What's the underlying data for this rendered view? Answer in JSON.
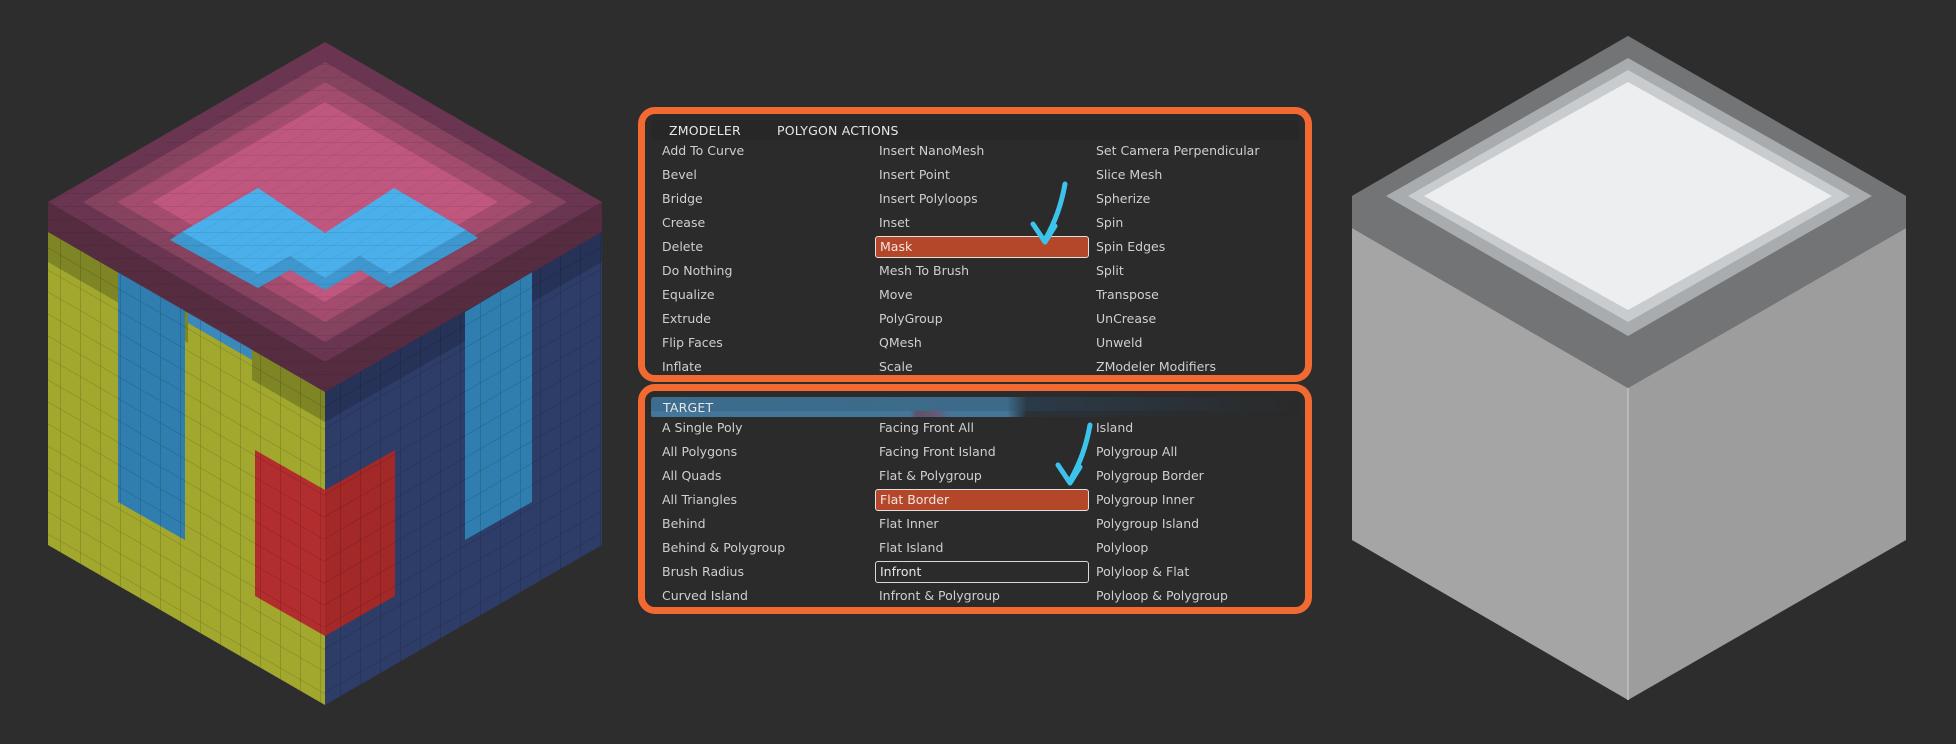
{
  "zmodeler_panel": {
    "tab_zmodeler": "ZMODELER",
    "tab_polygon_actions": "POLYGON ACTIONS",
    "col1": [
      "Add To Curve",
      "Bevel",
      "Bridge",
      "Crease",
      "Delete",
      "Do Nothing",
      "Equalize",
      "Extrude",
      "Flip Faces",
      "Inflate"
    ],
    "col2": [
      "Insert NanoMesh",
      "Insert Point",
      "Insert Polyloops",
      "Inset",
      "Mask",
      "Mesh To Brush",
      "Move",
      "PolyGroup",
      "QMesh",
      "Scale"
    ],
    "col3": [
      "Set Camera Perpendicular",
      "Slice Mesh",
      "Spherize",
      "Spin",
      "Spin Edges",
      "Split",
      "Transpose",
      "UnCrease",
      "Unweld",
      "ZModeler Modifiers"
    ],
    "selected": "Mask"
  },
  "target_panel": {
    "title": "TARGET",
    "col1": [
      "A Single Poly",
      "All Polygons",
      "All Quads",
      "All Triangles",
      "Behind",
      "Behind & Polygroup",
      "Brush Radius",
      "Curved Island"
    ],
    "col2": [
      "Facing Front All",
      "Facing Front Island",
      "Flat & Polygroup",
      "Flat Border",
      "Flat Inner",
      "Flat Island",
      "Infront",
      "Infront & Polygroup"
    ],
    "col3": [
      "Island",
      "Polygroup All",
      "Polygroup Border",
      "Polygroup Inner",
      "Polygroup Island",
      "Polyloop",
      "Polyloop & Flat",
      "Polyloop & Polygroup"
    ],
    "selected": "Flat Border",
    "outlined": "Infront"
  },
  "colors": {
    "accent_orange": "#f26a32",
    "selected_fill": "#b4472a",
    "arrow_cyan": "#3cc3ec",
    "cube_pink": "#c0577e",
    "cube_blue": "#4ab0ec",
    "cube_yellow": "#a2a82e",
    "cube_navy": "#2e3c68",
    "cube_red": "#b22d2d"
  }
}
